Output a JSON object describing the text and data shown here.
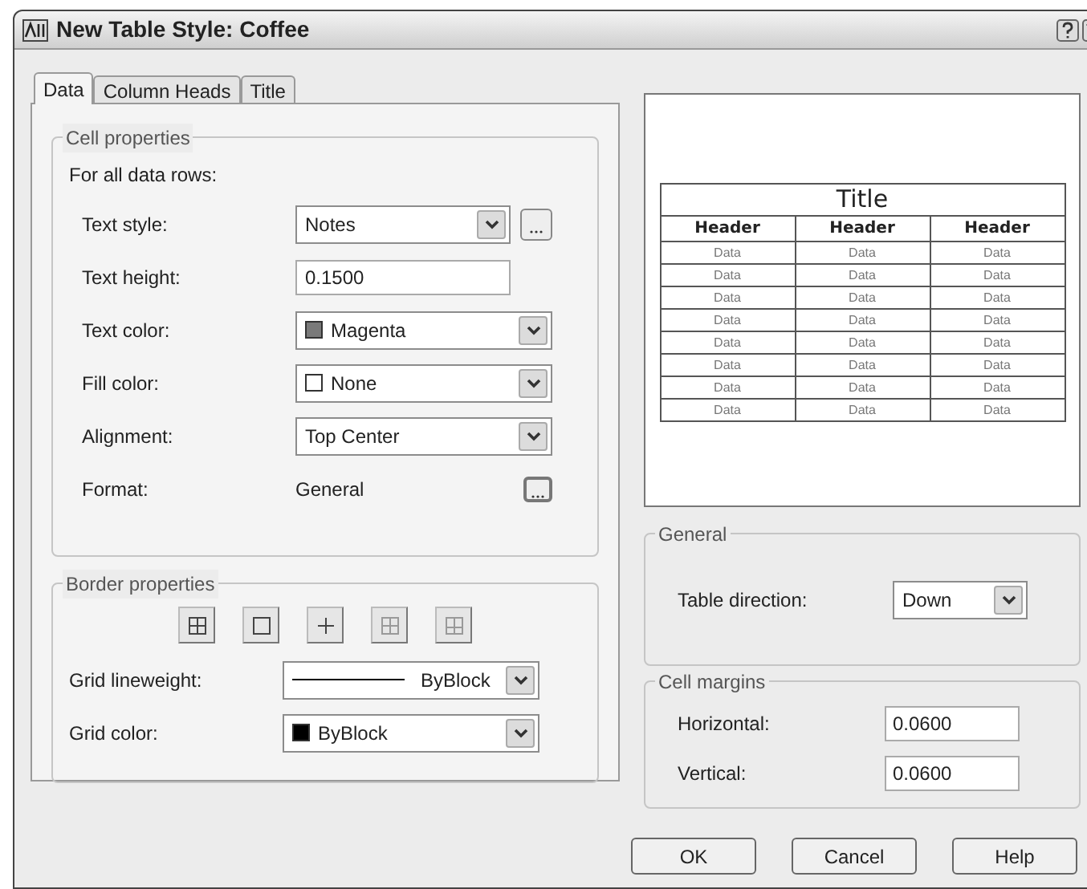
{
  "window": {
    "title": "New Table Style: Coffee"
  },
  "tabs": [
    {
      "label": "Data",
      "selected": true
    },
    {
      "label": "Column Heads",
      "selected": false
    },
    {
      "label": "Title",
      "selected": false
    }
  ],
  "cell_properties": {
    "legend": "Cell properties",
    "subtitle": "For all data rows:",
    "rows": [
      {
        "kind": "dropdown",
        "label": "Text style:",
        "value": "Notes",
        "has_browse": true
      },
      {
        "kind": "input",
        "label": "Text height:",
        "value": "0.1500"
      },
      {
        "kind": "color",
        "label": "Text color:",
        "value": "Magenta",
        "color": "#7a7a7a"
      },
      {
        "kind": "color",
        "label": "Fill color:",
        "value": "None",
        "color": "#ffffff"
      },
      {
        "kind": "dropdown",
        "label": "Alignment:",
        "value": "Top Center",
        "has_browse": false
      },
      {
        "kind": "text",
        "label": "Format:",
        "value": "General"
      }
    ]
  },
  "border_properties": {
    "legend": "Border properties",
    "rows": [
      {
        "kind": "lineweight",
        "label": "Grid lineweight:",
        "value": "ByBlock"
      },
      {
        "kind": "color",
        "label": "Grid color:",
        "value": "ByBlock",
        "color": "#000000"
      }
    ]
  },
  "preview": {
    "title": "Title",
    "headers": [
      "Header",
      "Header",
      "Header"
    ],
    "rows": [
      [
        "Data",
        "Data",
        "Data"
      ],
      [
        "Data",
        "Data",
        "Data"
      ],
      [
        "Data",
        "Data",
        "Data"
      ],
      [
        "Data",
        "Data",
        "Data"
      ],
      [
        "Data",
        "Data",
        "Data"
      ],
      [
        "Data",
        "Data",
        "Data"
      ],
      [
        "Data",
        "Data",
        "Data"
      ],
      [
        "Data",
        "Data",
        "Data"
      ]
    ]
  },
  "general": {
    "legend": "General",
    "label": "Table direction:",
    "value": "Down"
  },
  "cell_margins": {
    "legend": "Cell margins",
    "rows": [
      {
        "label": "Horizontal:",
        "value": "0.0600"
      },
      {
        "label": "Vertical:",
        "value": "0.0600"
      }
    ]
  },
  "buttons": [
    "OK",
    "Cancel",
    "Help"
  ]
}
